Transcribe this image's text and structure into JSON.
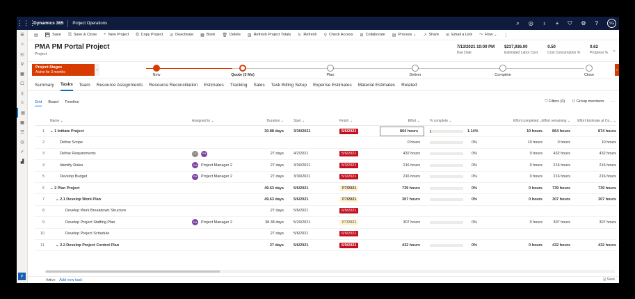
{
  "nav": {
    "app_name": "Dynamics 365",
    "module": "Project Operations",
    "user_initials": "SG"
  },
  "commands": [
    {
      "icon": "▤",
      "label": ""
    },
    {
      "icon": "💾",
      "label": "Save"
    },
    {
      "icon": "🖫",
      "label": "Save & Close"
    },
    {
      "icon": "+",
      "label": "New Project"
    },
    {
      "icon": "⧉",
      "label": "Copy Project"
    },
    {
      "icon": "⊘",
      "label": "Deactivate"
    },
    {
      "icon": "▦",
      "label": "Book"
    },
    {
      "icon": "🗑",
      "label": "Delete"
    },
    {
      "icon": "▥",
      "label": "Refresh Project Totals"
    },
    {
      "icon": "↻",
      "label": "Refresh"
    },
    {
      "icon": "⚲",
      "label": "Check Access"
    },
    {
      "icon": "⊞",
      "label": "Collaborate"
    },
    {
      "icon": "▤",
      "label": "Process ⌄"
    },
    {
      "icon": "↗",
      "label": "Share"
    },
    {
      "icon": "✉",
      "label": "Email a Link"
    },
    {
      "icon": "⤳",
      "label": "Flow ⌄"
    },
    {
      "icon": "⋮",
      "label": ""
    }
  ],
  "header": {
    "title": "PMA PM Portal Project",
    "subtitle": "Project",
    "fields": [
      {
        "value": "7/13/2021 10:00 PM",
        "label": "Due Date"
      },
      {
        "value": "$237,936.00",
        "label": "Estimated Labor Cost"
      },
      {
        "value": "0.50",
        "label": "Cost Consumption %"
      },
      {
        "value": "0.62",
        "label": "Progress %"
      }
    ]
  },
  "bpf": {
    "stage_title": "Project Stages",
    "stage_sub": "Active for 3 months",
    "stages": [
      "New",
      "Quote (3 Mo)",
      "Plan",
      "Deliver",
      "Complete",
      "Close"
    ]
  },
  "tabs": [
    "Summary",
    "Tasks",
    "Team",
    "Resource Assignments",
    "Resource Reconciliation",
    "Estimates",
    "Tracking",
    "Sales",
    "Task Billing Setup",
    "Expense Estimates",
    "Material Estimates",
    "Related"
  ],
  "subtabs": [
    "Grid",
    "Board",
    "Timeline"
  ],
  "grid_tools": {
    "filters": "Filters (0)",
    "group": "Group members",
    "more": "···"
  },
  "columns": {
    "name": "Name ⌄",
    "assigned": "Assigned to ⌄",
    "duration": "Duration ⌄",
    "start": "Start ⌄",
    "finish": "Finish ⌄",
    "effort": "Effort ⌄",
    "pct": "% complete ⌄",
    "effort_completed": "Effort completed ⌄",
    "effort_remaining": "Effort remaining ⌄",
    "effort_at_completion": "Effort Estimate at Co... ⌄"
  },
  "rows": [
    {
      "n": "1",
      "name": "⌄ 1 Initiate Project",
      "level": 0,
      "summary": true,
      "avatars": [],
      "assigned": "",
      "duration": "30.88 days",
      "start": "3/30/2021",
      "finish": "5/6/2021",
      "finish_style": "red",
      "effort": "864 hours",
      "pct_value": 1.14,
      "pct": "1.14%",
      "ec": "10 hours",
      "er": "864 hours",
      "ea": "874 hours"
    },
    {
      "n": "2",
      "name": "Define Scope",
      "level": 1,
      "summary": false,
      "avatars": [],
      "assigned": "",
      "duration": "",
      "start": "",
      "finish": "",
      "finish_style": "",
      "effort": "0 hours",
      "pct_value": 0,
      "pct": "0%",
      "ec": "10 hours",
      "er": "0 hours",
      "ea": "10 hours"
    },
    {
      "n": "3",
      "name": "Define Requirements",
      "level": 1,
      "summary": false,
      "avatars": [
        "LS",
        "PM"
      ],
      "assigned": "",
      "duration": "27 days",
      "start": "4/2/2021",
      "finish": "5/6/2021",
      "finish_style": "red",
      "effort": "432 hours",
      "pct_value": 0,
      "pct": "0%",
      "ec": "0 hours",
      "er": "432 hours",
      "ea": "432 hours"
    },
    {
      "n": "4",
      "name": "Identify Roles",
      "level": 1,
      "summary": false,
      "avatars": [
        "PM"
      ],
      "assigned": "Project Manager 2",
      "duration": "27 days",
      "start": "3/30/2021",
      "finish": "5/3/2021",
      "finish_style": "red",
      "effort": "216 hours",
      "pct_value": 0,
      "pct": "0%",
      "ec": "0 hours",
      "er": "216 hours",
      "ea": "216 hours"
    },
    {
      "n": "5",
      "name": "Develop Budget",
      "level": 1,
      "summary": false,
      "avatars": [
        "PM"
      ],
      "assigned": "Project Manager 2",
      "duration": "27 days",
      "start": "3/30/2021",
      "finish": "5/3/2021",
      "finish_style": "red",
      "effort": "216 hours",
      "pct_value": 0,
      "pct": "0%",
      "ec": "0 hours",
      "er": "216 hours",
      "ea": "216 hours"
    },
    {
      "n": "6",
      "name": "⌄ 2 Plan Project",
      "level": 0,
      "summary": true,
      "avatars": [],
      "assigned": "",
      "duration": "49.63 days",
      "start": "5/6/2021",
      "finish": "7/7/2021",
      "finish_style": "yellow",
      "effort": "739 hours",
      "pct_value": 0,
      "pct": "0%",
      "ec": "0 hours",
      "er": "739 hours",
      "ea": "739 hours"
    },
    {
      "n": "7",
      "name": "⌄ 2.1 Develop Work Plan",
      "level": 1,
      "summary": true,
      "avatars": [],
      "assigned": "",
      "duration": "49.63 days",
      "start": "5/6/2021",
      "finish": "7/7/2021",
      "finish_style": "yellow",
      "effort": "307 hours",
      "pct_value": 0,
      "pct": "0%",
      "ec": "0 hours",
      "er": "307 hours",
      "ea": "307 hours"
    },
    {
      "n": "8",
      "name": "Develop Work Breakdown Structure",
      "level": 2,
      "summary": false,
      "avatars": [],
      "assigned": "",
      "duration": "27 days",
      "start": "5/6/2021",
      "finish": "6/9/2021",
      "finish_style": "red",
      "effort": "",
      "pct_value": 0,
      "pct": "",
      "ec": "",
      "er": "",
      "ea": ""
    },
    {
      "n": "9",
      "name": "Develop Project Staffing Plan",
      "level": 2,
      "summary": false,
      "avatars": [
        "PM"
      ],
      "assigned": "Project Manager 2",
      "duration": "38.38 days",
      "start": "5/20/2021",
      "finish": "7/7/2021",
      "finish_style": "yellow",
      "effort": "307 hours",
      "pct_value": 0,
      "pct": "0%",
      "ec": "0 hours",
      "er": "307 hours",
      "ea": "307 hours"
    },
    {
      "n": "10",
      "name": "Develop Project Schedule",
      "level": 2,
      "summary": false,
      "avatars": [],
      "assigned": "",
      "duration": "27 days",
      "start": "5/6/2021",
      "finish": "6/9/2021",
      "finish_style": "red",
      "effort": "",
      "pct_value": 0,
      "pct": "",
      "ec": "",
      "er": "",
      "ea": ""
    },
    {
      "n": "11",
      "name": "⌄ 2.2 Develop Project Control Plan",
      "level": 1,
      "summary": true,
      "avatars": [],
      "assigned": "",
      "duration": "27 days",
      "start": "5/6/2021",
      "finish": "6/9/2021",
      "finish_style": "red",
      "effort": "432 hours",
      "pct_value": 0,
      "pct": "0%",
      "ec": "0 hours",
      "er": "432 hours",
      "ea": "432 hours"
    }
  ],
  "add_task": "Add new task",
  "footer": {
    "status": "Active",
    "save": "Save"
  },
  "colors": {
    "accent": "#0f6cbd",
    "stage": "#d83b01",
    "late": "#c50f1f",
    "nav": "#0f1b3d"
  }
}
